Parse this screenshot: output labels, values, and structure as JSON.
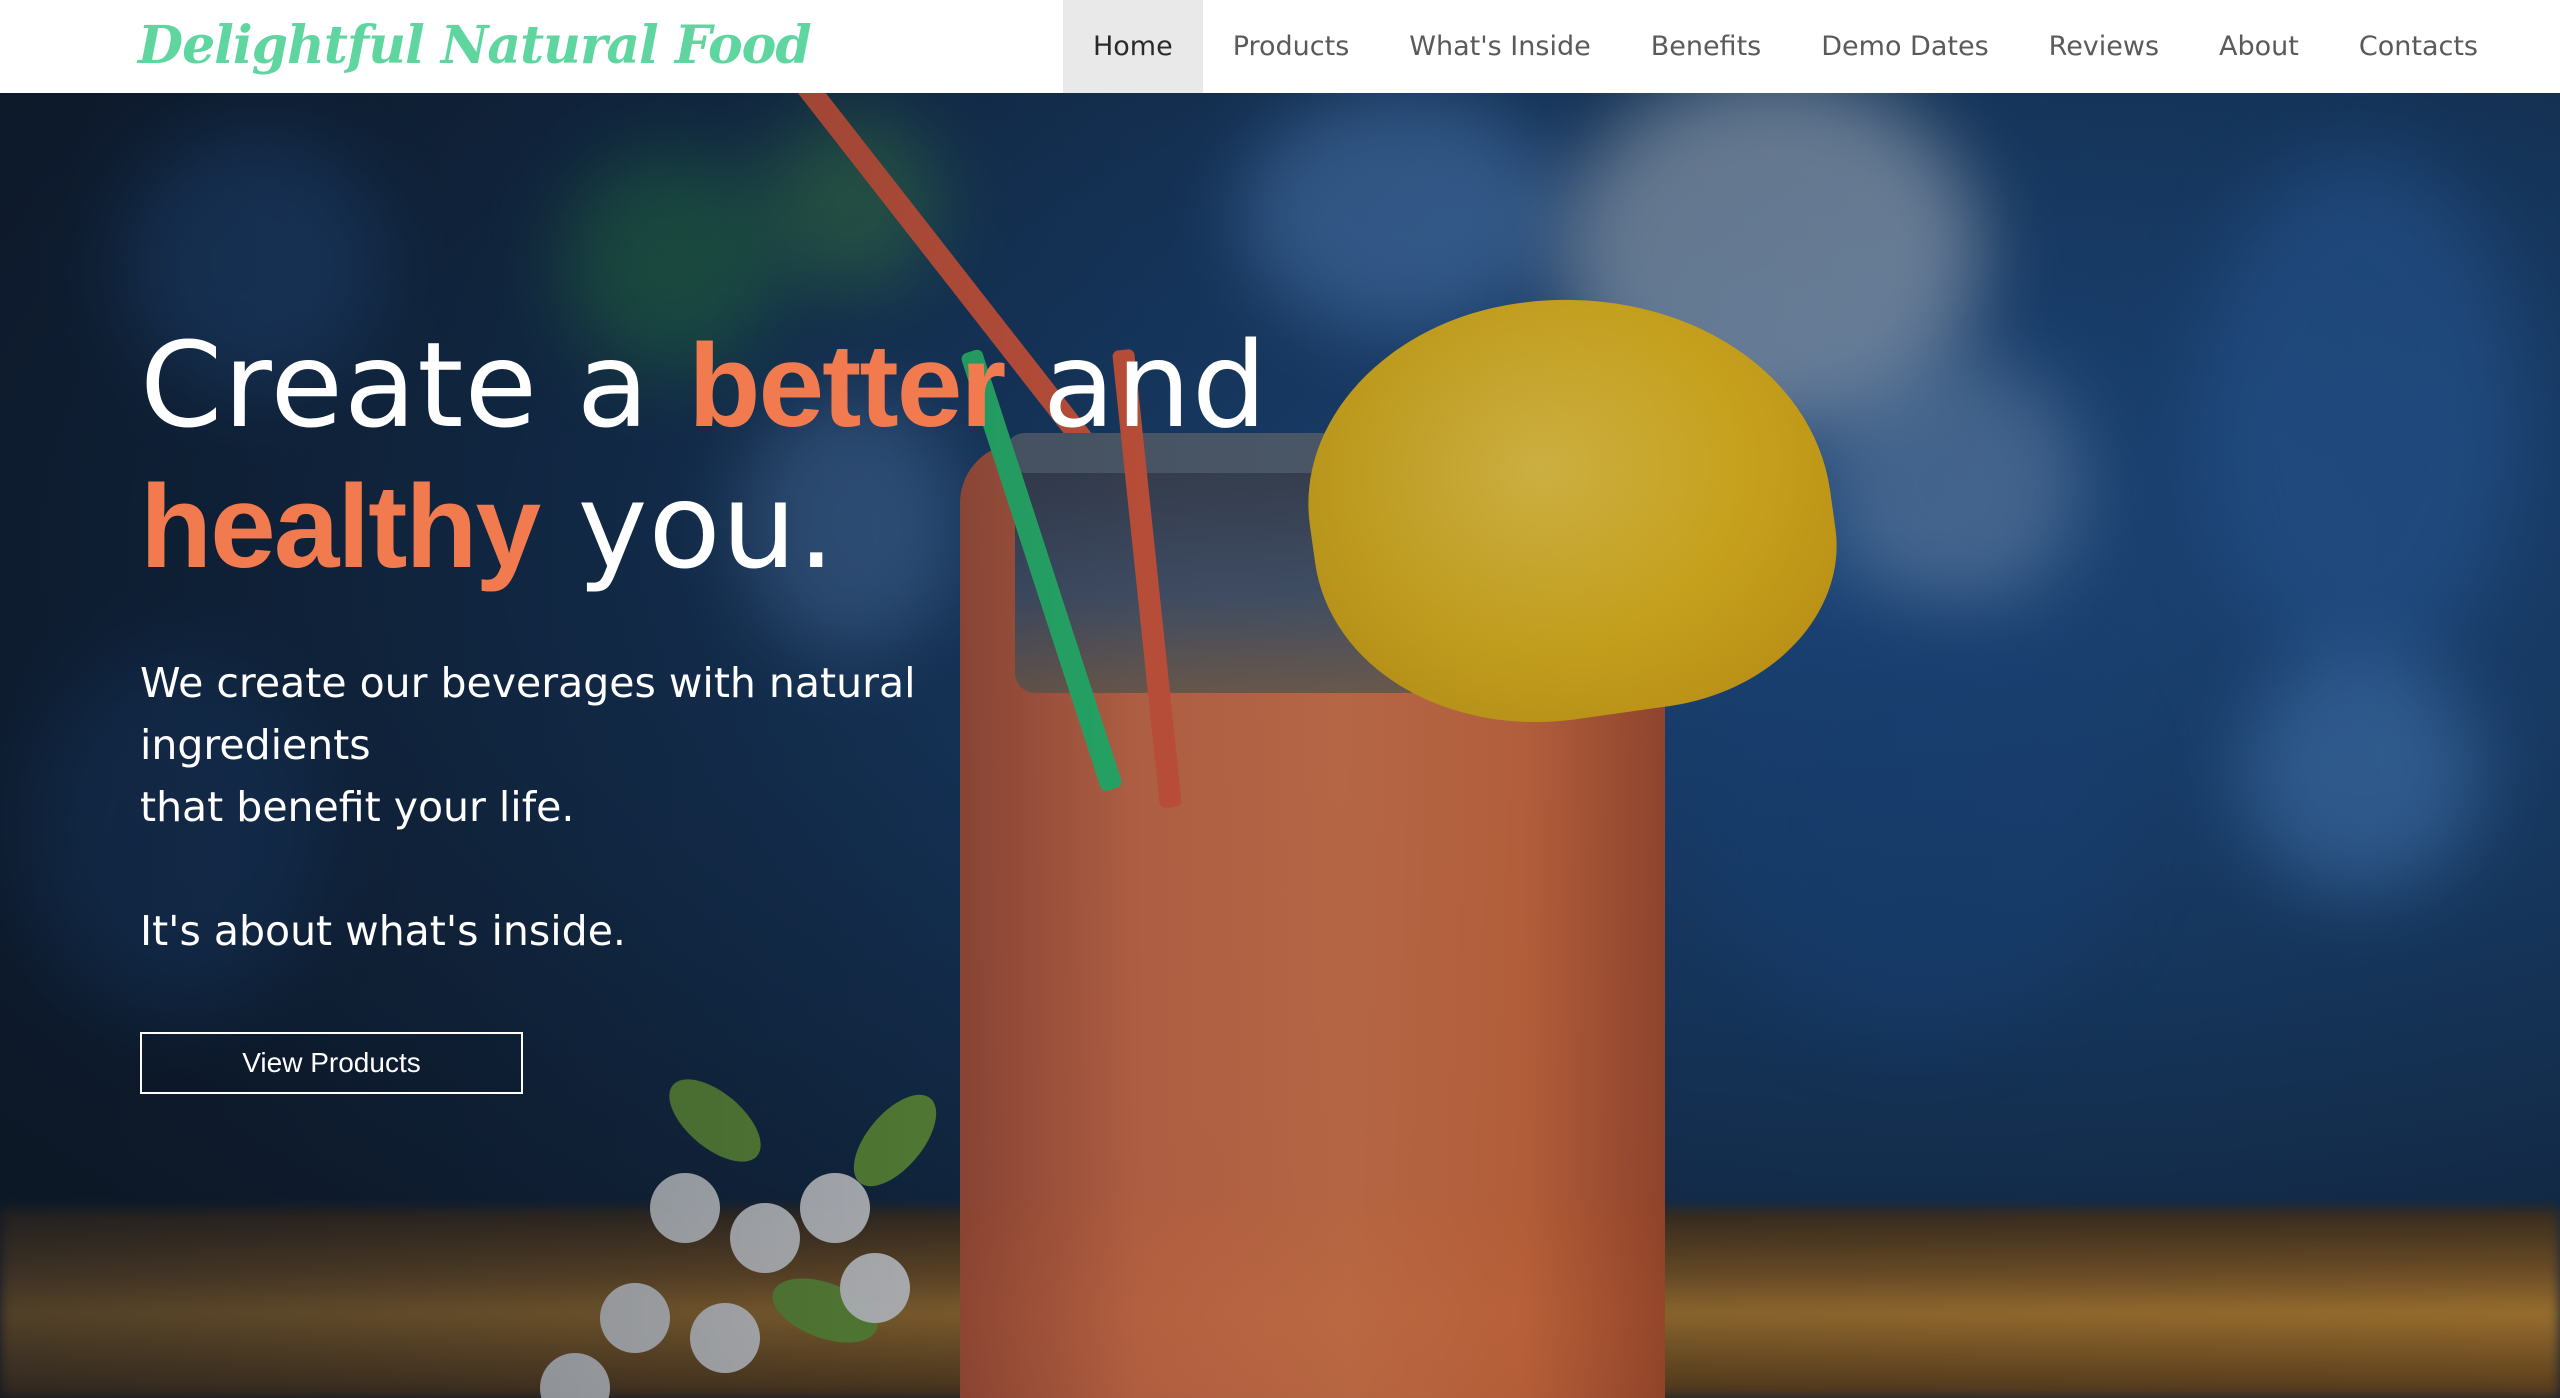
{
  "brand": {
    "logo_text": "Delightful Natural Food",
    "logo_color": "#5fd6a0",
    "accent_color": "#f27a4f"
  },
  "nav": {
    "items": [
      {
        "label": "Home",
        "active": true
      },
      {
        "label": "Products",
        "active": false
      },
      {
        "label": "What's Inside",
        "active": false
      },
      {
        "label": "Benefits",
        "active": false
      },
      {
        "label": "Demo Dates",
        "active": false
      },
      {
        "label": "Reviews",
        "active": false
      },
      {
        "label": "About",
        "active": false
      },
      {
        "label": "Contacts",
        "active": false
      }
    ]
  },
  "hero": {
    "headline": {
      "part1": "Create a ",
      "accent1": "better",
      "part2": " and",
      "accent2": "healthy",
      "part3": " you."
    },
    "subtext_line1": "We create our beverages with natural ingredients",
    "subtext_line2": "that benefit your life.",
    "tagline": "It's about what's inside.",
    "cta_label": "View Products"
  }
}
